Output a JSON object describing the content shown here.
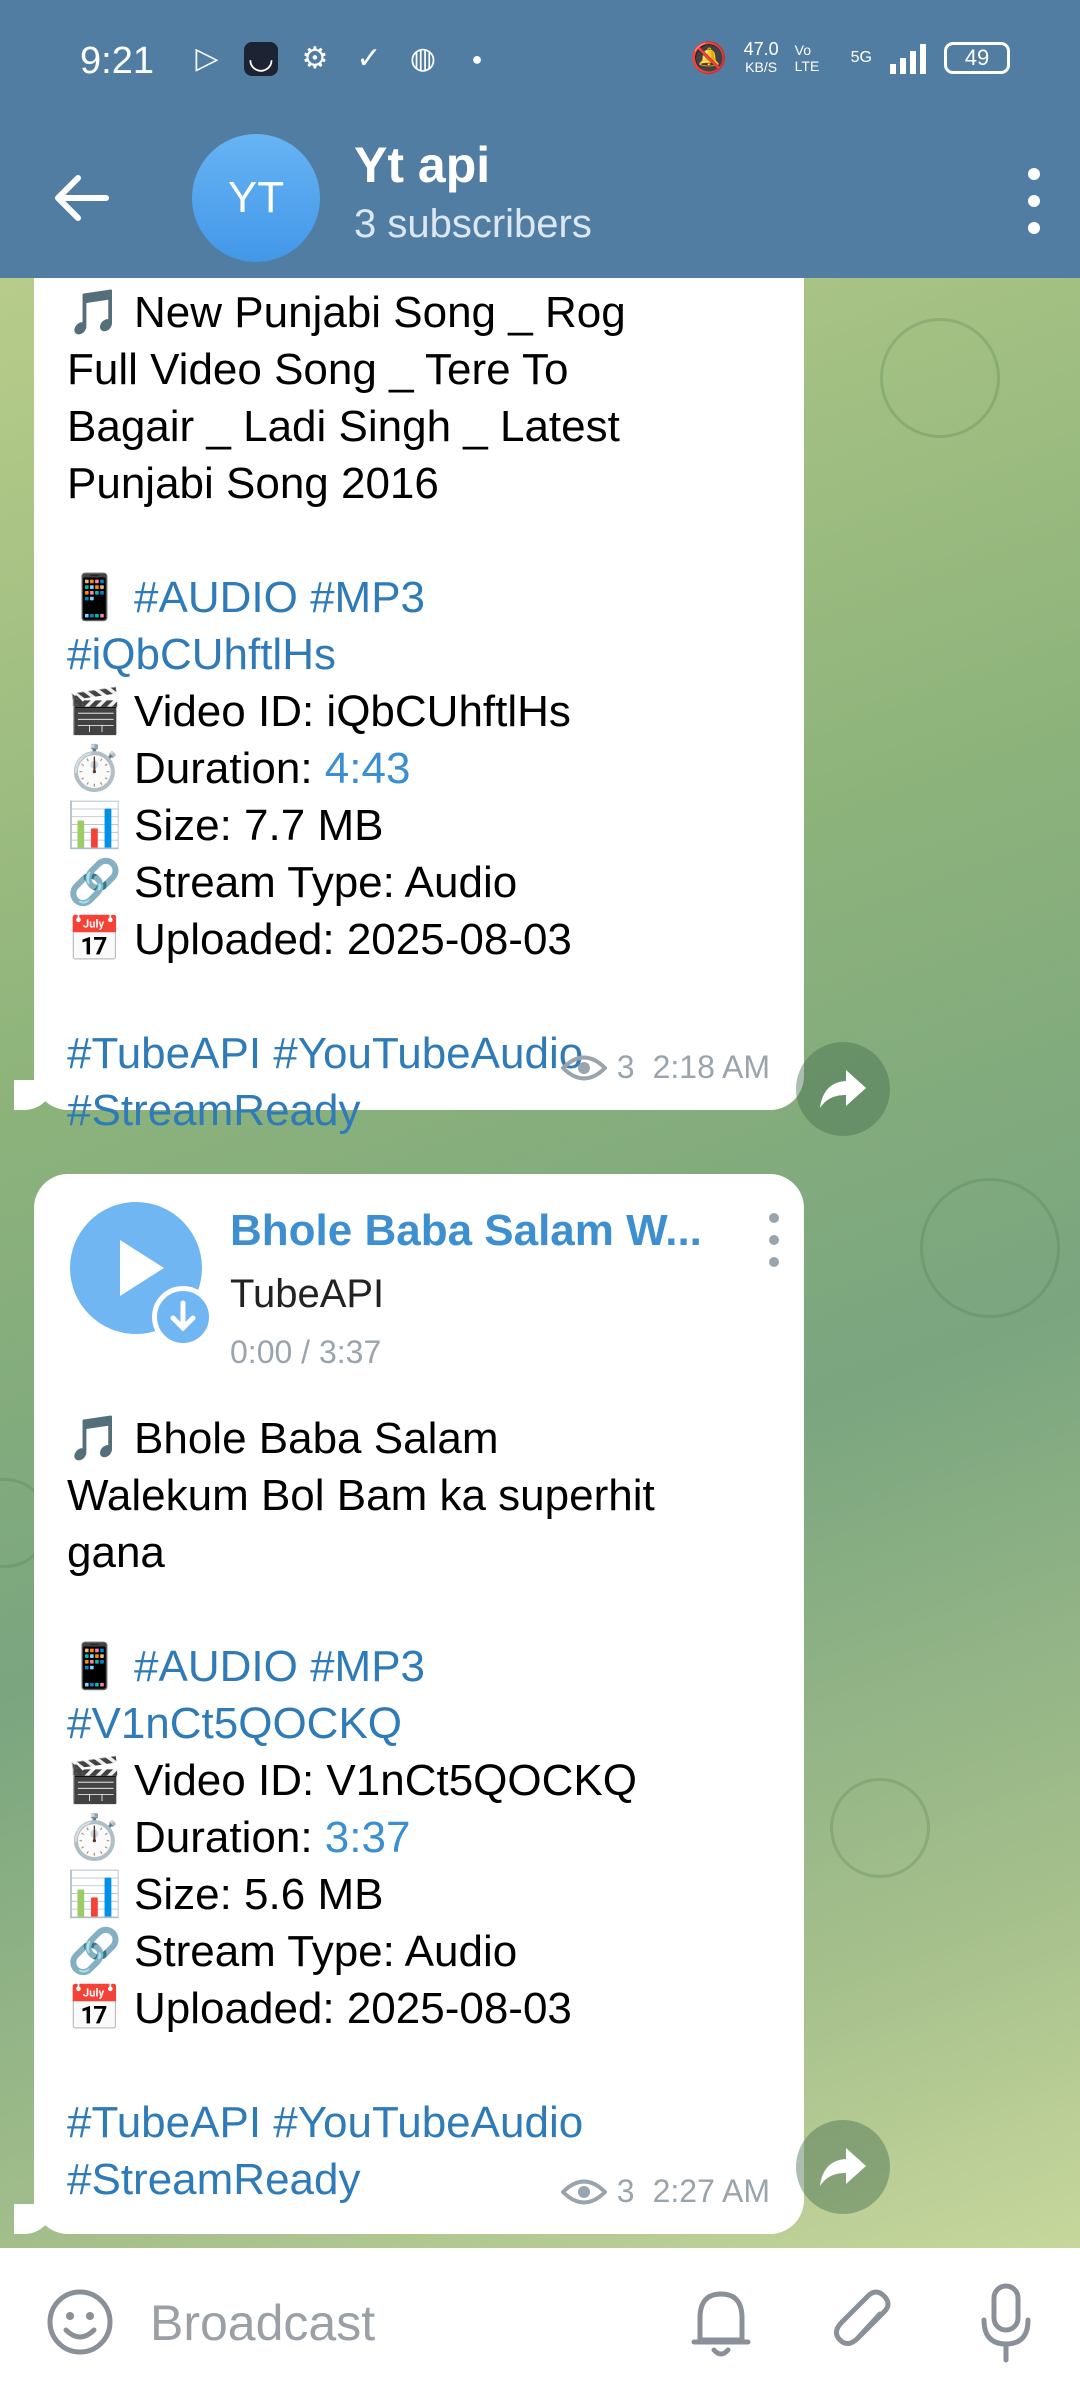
{
  "status_bar": {
    "time": "9:21",
    "net_speed": "47.0",
    "net_unit": "KB/S",
    "volte": "Vo LTE",
    "network": "5G",
    "battery": "49"
  },
  "header": {
    "avatar_initials": "YT",
    "title": "Yt api",
    "subtitle": "3 subscribers"
  },
  "messages": [
    {
      "lines": [
        "🎵 New Punjabi Song _ Rog",
        "Full Video Song _ Tere To",
        "Bagair _ Ladi Singh _ Latest",
        "Punjabi Song 2016"
      ],
      "tags_line1_emoji": "📱",
      "tags_line1": "#AUDIO #MP3",
      "tags_line2": "#iQbCUhftlHs",
      "video_id": "🎬 Video ID: iQbCUhftlHs",
      "duration_label": "⏱️ Duration: ",
      "duration_value": "4:43",
      "size": "📊 Size: 7.7 MB",
      "stream_type": "🔗 Stream Type: Audio",
      "uploaded": "📅 Uploaded: 2025-08-03",
      "footer_tags_1": "#TubeAPI #YouTubeAudio",
      "footer_tags_2": "#StreamReady",
      "views": "3",
      "time": "2:18 AM"
    },
    {
      "audio_title": "Bhole Baba Salam W...",
      "audio_artist": "TubeAPI",
      "audio_time": "0:00 / 3:37",
      "lines": [
        "🎵 Bhole Baba Salam",
        "Walekum Bol Bam ka superhit",
        "gana"
      ],
      "tags_line1_emoji": "📱",
      "tags_line1": "#AUDIO #MP3",
      "tags_line2": "#V1nCt5QOCKQ",
      "video_id": "🎬 Video ID: V1nCt5QOCKQ",
      "duration_label": "⏱️ Duration: ",
      "duration_value": "3:37",
      "size": "📊 Size: 5.6 MB",
      "stream_type": "🔗 Stream Type: Audio",
      "uploaded": "📅 Uploaded: 2025-08-03",
      "footer_tags_1": "#TubeAPI #YouTubeAudio",
      "footer_tags_2": "#StreamReady",
      "views": "3",
      "time": "2:27 AM"
    }
  ],
  "composer": {
    "placeholder": "Broadcast"
  },
  "colors": {
    "header_bg": "#527da3",
    "link": "#2f7bb8",
    "accent": "#6fb6f2"
  }
}
